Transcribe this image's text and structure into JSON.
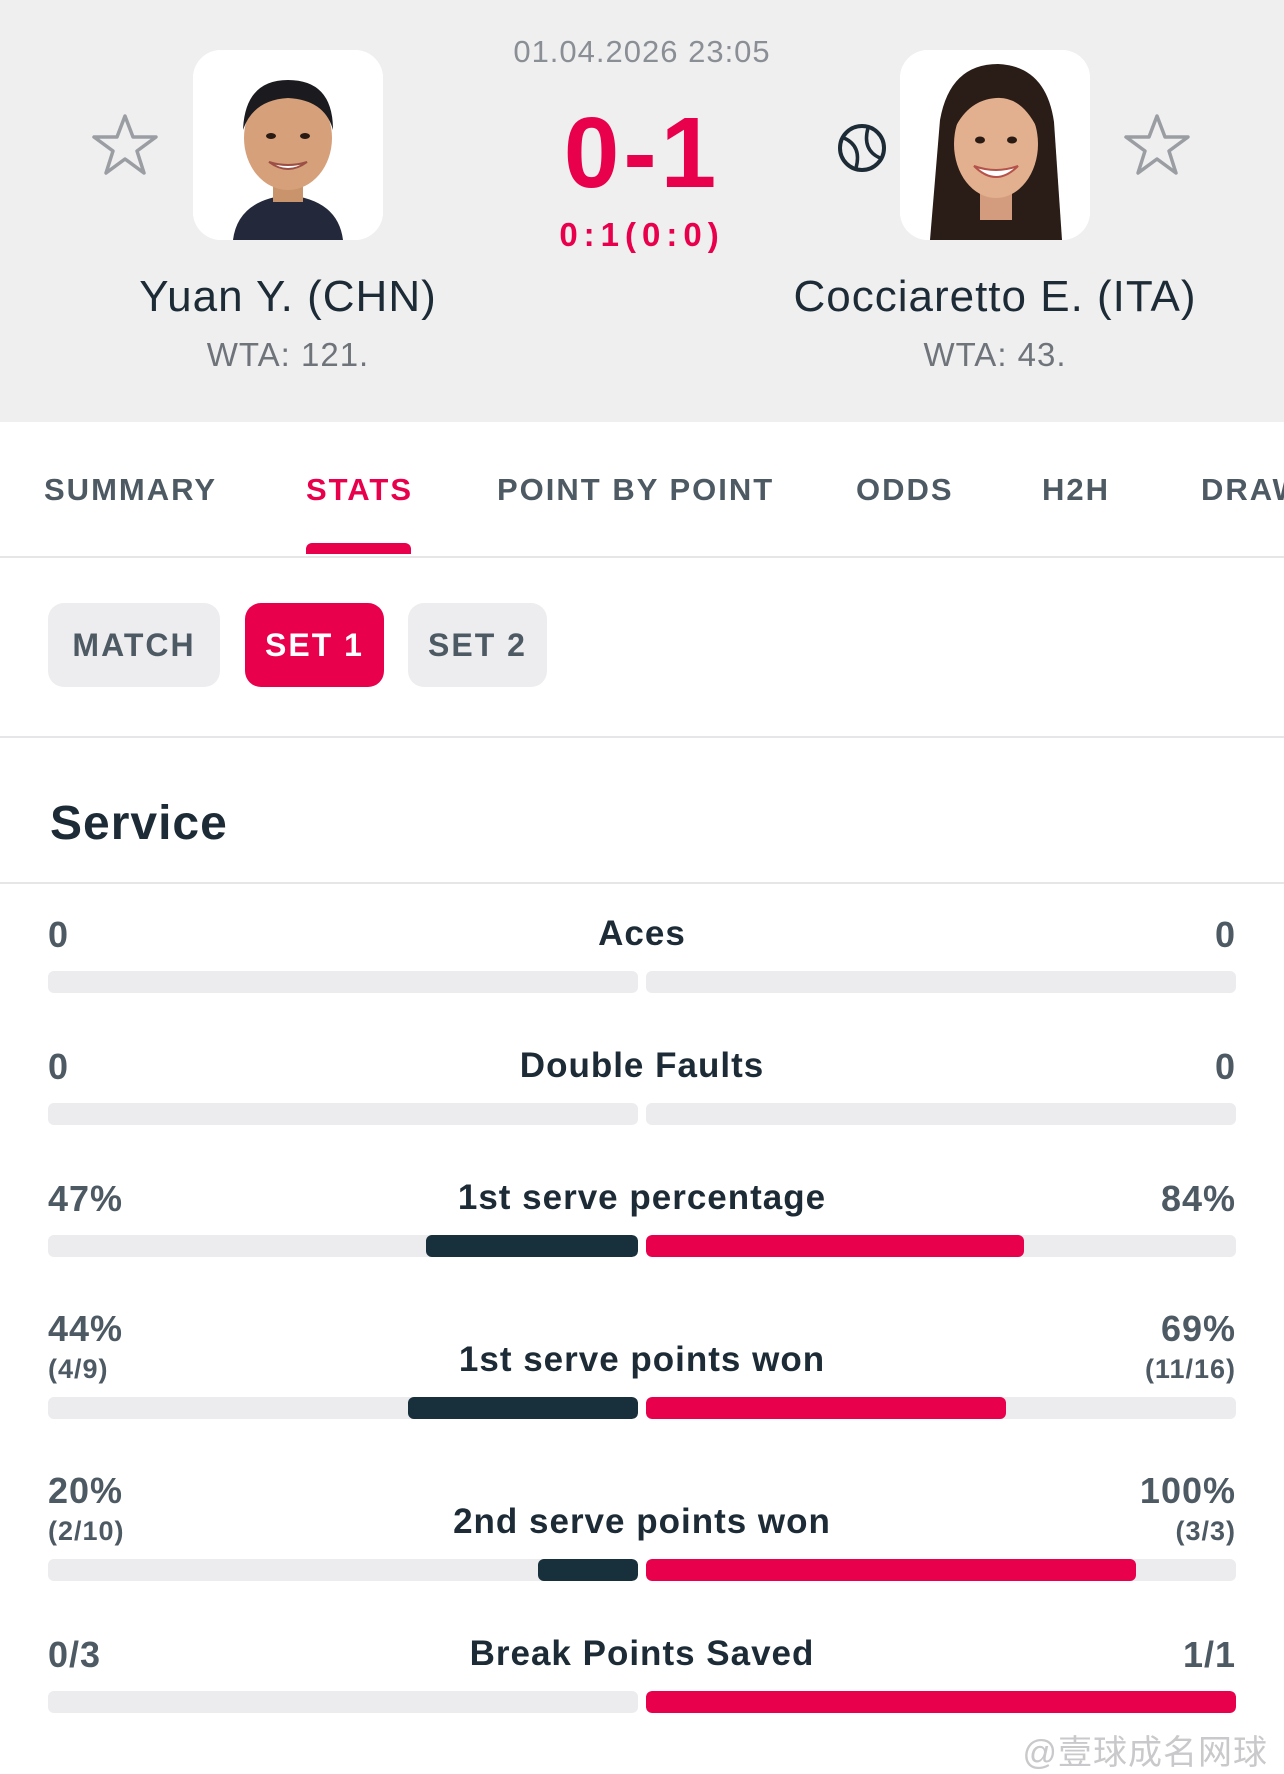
{
  "match": {
    "datetime": "01.04.2026 23:05",
    "score": "0-1",
    "set_score": "0:1(0:0)"
  },
  "players": {
    "left": {
      "name": "Yuan Y. (CHN)",
      "rank": "WTA: 121."
    },
    "right": {
      "name": "Cocciaretto E. (ITA)",
      "rank": "WTA: 43.",
      "serving": true
    }
  },
  "tabs": [
    {
      "label": "SUMMARY",
      "active": false
    },
    {
      "label": "STATS",
      "active": true
    },
    {
      "label": "POINT BY POINT",
      "active": false
    },
    {
      "label": "ODDS",
      "active": false
    },
    {
      "label": "H2H",
      "active": false
    },
    {
      "label": "DRAW",
      "active": false
    }
  ],
  "filters": [
    {
      "label": "MATCH",
      "active": false
    },
    {
      "label": "SET 1",
      "active": true
    },
    {
      "label": "SET 2",
      "active": false
    }
  ],
  "section": {
    "title": "Service"
  },
  "stats": [
    {
      "label": "Aces",
      "left": "0",
      "right": "0",
      "left_sub": "",
      "right_sub": "",
      "left_fraction": 0,
      "right_fraction": 0
    },
    {
      "label": "Double Faults",
      "left": "0",
      "right": "0",
      "left_sub": "",
      "right_sub": "",
      "left_fraction": 0,
      "right_fraction": 0
    },
    {
      "label": "1st serve percentage",
      "left": "47%",
      "right": "84%",
      "left_sub": "",
      "right_sub": "",
      "left_fraction": 0.36,
      "right_fraction": 0.64
    },
    {
      "label": "1st serve points won",
      "left": "44%",
      "right": "69%",
      "left_sub": "(4/9)",
      "right_sub": "(11/16)",
      "left_fraction": 0.39,
      "right_fraction": 0.61
    },
    {
      "label": "2nd serve points won",
      "left": "20%",
      "right": "100%",
      "left_sub": "(2/10)",
      "right_sub": "(3/3)",
      "left_fraction": 0.17,
      "right_fraction": 0.83
    },
    {
      "label": "Break Points Saved",
      "left": "0/3",
      "right": "1/1",
      "left_sub": "",
      "right_sub": "",
      "left_fraction": 0,
      "right_fraction": 1.0
    }
  ],
  "icons": {
    "favorite": "star-outline-icon",
    "serve_indicator": "tennis-ball-icon"
  },
  "colors": {
    "accent": "#e8004d",
    "left_bar": "#17303b",
    "header_bg": "#efeff0"
  },
  "watermark": "@壹球成名网球"
}
